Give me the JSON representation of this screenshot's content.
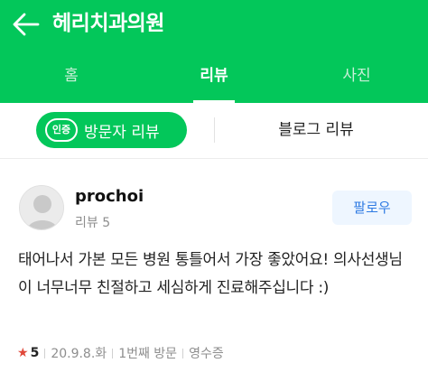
{
  "header": {
    "title": "헤리치과의원",
    "back_icon": "arrow-left-icon",
    "accent": "#03c75a"
  },
  "tabs": [
    {
      "label": "홈",
      "active": false
    },
    {
      "label": "리뷰",
      "active": true
    },
    {
      "label": "사진",
      "active": false
    }
  ],
  "subtabs": {
    "visitor_badge": "인증",
    "visitor_label": "방문자 리뷰",
    "blog_label": "블로그 리뷰"
  },
  "review": {
    "username": "prochoi",
    "review_count": "리뷰 5",
    "follow_label": "팔로우",
    "text": "태어나서 가본 모든 병원 통틀어서 가장 좋았어요! 의사선생님이 너무너무 친절하고 세심하게 진료해주십니다 :)",
    "rating": "5",
    "date": "20.9.8.화",
    "visit": "1번째 방문",
    "receipt": "영수증"
  }
}
